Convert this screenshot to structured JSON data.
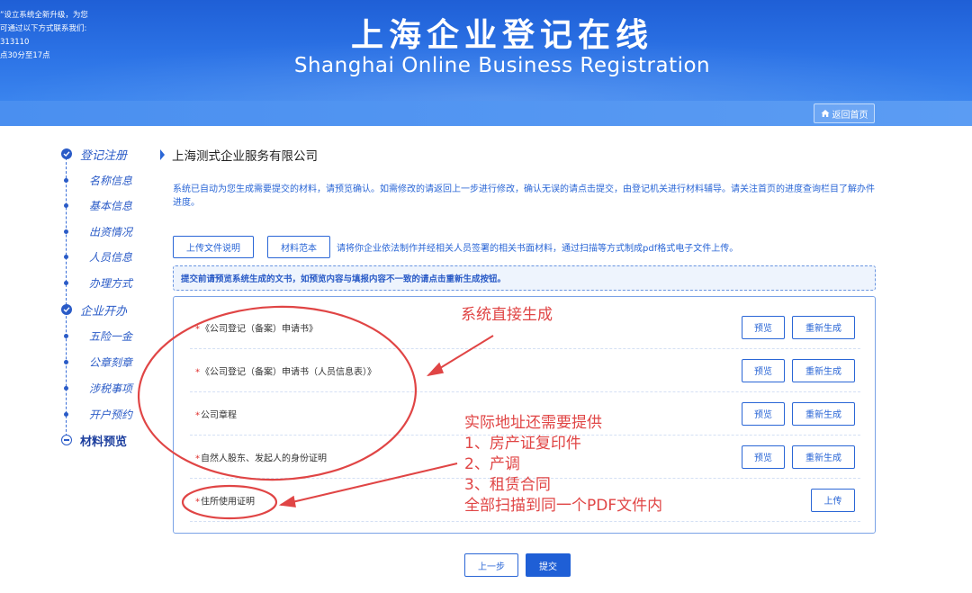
{
  "header": {
    "notice_lines": [
      "”设立系统全新升级，为您",
      "可通过以下方式联系我们:",
      "313110",
      "点30分至17点"
    ],
    "title": "上海企业登记在线",
    "subtitle": "Shanghai Online Business Registration",
    "home_button": "返回首页",
    "home_icon": "home-icon"
  },
  "sidebar": {
    "items": [
      {
        "label": "登记注册",
        "level": "main",
        "state": "done"
      },
      {
        "label": "名称信息",
        "level": "sub"
      },
      {
        "label": "基本信息",
        "level": "sub"
      },
      {
        "label": "出资情况",
        "level": "sub"
      },
      {
        "label": "人员信息",
        "level": "sub"
      },
      {
        "label": "办理方式",
        "level": "sub"
      },
      {
        "label": "企业开办",
        "level": "main",
        "state": "done"
      },
      {
        "label": "五险一金",
        "level": "sub"
      },
      {
        "label": "公章刻章",
        "level": "sub"
      },
      {
        "label": "涉税事项",
        "level": "sub"
      },
      {
        "label": "开户预约",
        "level": "sub"
      },
      {
        "label": "材料预览",
        "level": "main",
        "state": "current"
      }
    ]
  },
  "main": {
    "company_name": "上海测式企业服务有限公司",
    "notice": "系统已自动为您生成需要提交的材料，请预览确认。如需修改的请返回上一步进行修改，确认无误的请点击提交，由登记机关进行材料辅导。请关注首页的进度查询栏目了解办件进度。",
    "upload_desc_button": "上传文件说明",
    "material_sample_button": "材料范本",
    "upload_hint": "请将你企业依法制作并经相关人员签署的相关书面材料，通过扫描等方式制成pdf格式电子文件上传。",
    "warning": "提交前请预览系统生成的文书，如预览内容与填报内容不一致的请点击重新生成按钮。",
    "documents": [
      {
        "label": "《公司登记（备案）申请书》",
        "required": "*",
        "preview": "预览",
        "regenerate": "重新生成"
      },
      {
        "label": "《公司登记（备案）申请书（人员信息表）》",
        "required": "*",
        "preview": "预览",
        "regenerate": "重新生成"
      },
      {
        "label": "公司章程",
        "required": "*",
        "preview": "预览",
        "regenerate": "重新生成"
      },
      {
        "label": "自然人股东、发起人的身份证明",
        "required": "*",
        "preview": "预览",
        "regenerate": "重新生成"
      },
      {
        "label": "住所使用证明",
        "required": "*",
        "upload": "上传"
      }
    ],
    "prev_button": "上一步",
    "submit_button": "提交"
  },
  "annotations": {
    "auto_generated": "系统直接生成",
    "address_lines": [
      "实际地址还需要提供",
      "1、房产证复印件",
      "2、产调",
      "3、租赁合同",
      "全部扫描到同一个PDF文件内"
    ],
    "color": "#e04545"
  }
}
